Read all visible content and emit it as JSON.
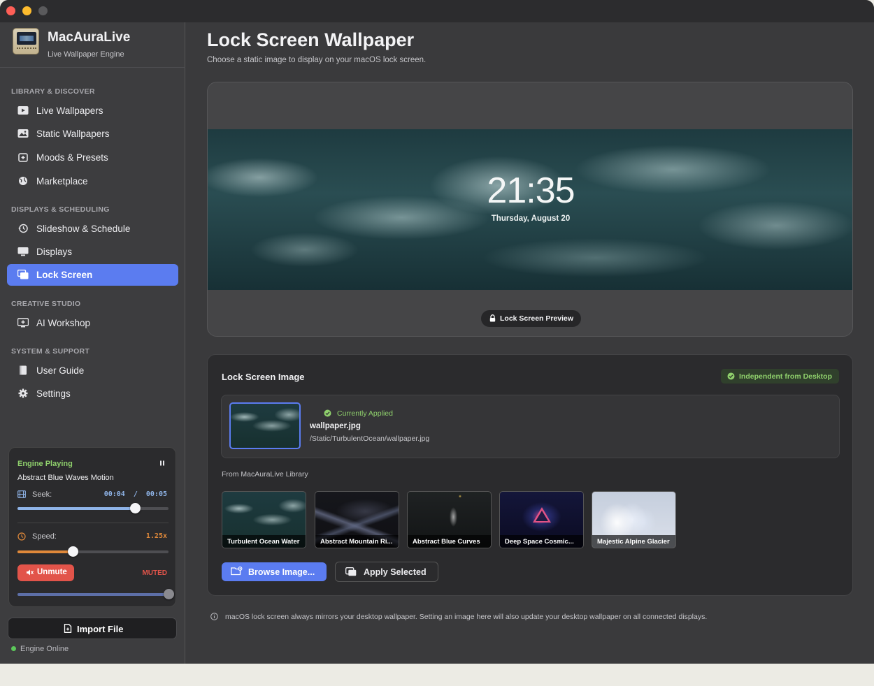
{
  "app": {
    "name": "MacAuraLive",
    "subtitle": "Live Wallpaper Engine"
  },
  "sidebar": {
    "sections": [
      {
        "label": "LIBRARY & DISCOVER"
      },
      {
        "label": "DISPLAYS & SCHEDULING"
      },
      {
        "label": "CREATIVE STUDIO"
      },
      {
        "label": "SYSTEM & SUPPORT"
      }
    ],
    "items": [
      {
        "label": "Live Wallpapers",
        "icon": "play-icon"
      },
      {
        "label": "Static Wallpapers",
        "icon": "image-icon"
      },
      {
        "label": "Moods & Presets",
        "icon": "preset-icon"
      },
      {
        "label": "Marketplace",
        "icon": "globe-icon"
      },
      {
        "label": "Slideshow & Schedule",
        "icon": "history-icon"
      },
      {
        "label": "Displays",
        "icon": "monitor-icon"
      },
      {
        "label": "Lock Screen",
        "icon": "lock-screen-icon",
        "active": true
      },
      {
        "label": "AI Workshop",
        "icon": "ai-icon"
      },
      {
        "label": "User Guide",
        "icon": "book-icon"
      },
      {
        "label": "Settings",
        "icon": "gear-icon"
      }
    ],
    "player": {
      "status": "Engine Playing",
      "track": "Abstract Blue Waves Motion",
      "seek_label": "Seek:",
      "seek_time": "00:04  /  00:05",
      "seek_progress": 0.78,
      "speed_label": "Speed:",
      "speed_value": "1.25x",
      "speed_progress": 0.37,
      "unmute_label": "Unmute",
      "muted_label": "MUTED",
      "volume_progress": 1.0
    },
    "import_label": "Import File",
    "engine_status": "Engine Online"
  },
  "main": {
    "title": "Lock Screen Wallpaper",
    "subtitle": "Choose a static image to display on your macOS lock screen.",
    "preview": {
      "time": "21:35",
      "date": "Thursday, August 20",
      "badge": "Lock Screen Preview"
    },
    "card": {
      "title": "Lock Screen Image",
      "independent_badge": "Independent from Desktop",
      "current": {
        "status": "Currently Applied",
        "filename": "wallpaper.jpg",
        "path": "/Static/TurbulentOcean/wallpaper.jpg"
      },
      "library_label": "From MacAuraLive Library",
      "library": [
        {
          "name": "Turbulent Ocean Water"
        },
        {
          "name": "Abstract Mountain Ri..."
        },
        {
          "name": "Abstract Blue Curves"
        },
        {
          "name": "Deep Space Cosmic..."
        },
        {
          "name": "Majestic Alpine Glacier"
        }
      ],
      "browse_label": "Browse Image...",
      "apply_label": "Apply Selected"
    },
    "note": "macOS lock screen always mirrors your desktop wallpaper. Setting an image here will also update your desktop wallpaper on all connected displays."
  },
  "colors": {
    "accent": "#5b7cf0",
    "success": "#8fd06c",
    "danger": "#e2544a",
    "speed": "#e0893a"
  }
}
